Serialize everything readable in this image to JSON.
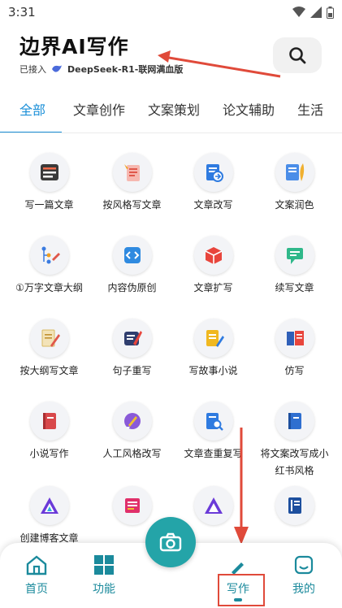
{
  "status": {
    "time": "3:31"
  },
  "header": {
    "title": "边界AI写作",
    "connected_label": "已接入",
    "model_name": "DeepSeek-R1-联网满血版"
  },
  "tabs": [
    {
      "label": "全部",
      "active": true
    },
    {
      "label": "文章创作"
    },
    {
      "label": "文案策划"
    },
    {
      "label": "论文辅助"
    },
    {
      "label": "生活"
    }
  ],
  "tools": [
    {
      "label": "写一篇文章",
      "icon": "notebook-icon"
    },
    {
      "label": "按风格写文章",
      "icon": "style-notes-icon"
    },
    {
      "label": "文章改写",
      "icon": "document-rewrite-icon"
    },
    {
      "label": "文案润色",
      "icon": "polish-icon"
    },
    {
      "label": "①万字文章大纲",
      "icon": "outline-icon"
    },
    {
      "label": "内容伪原创",
      "icon": "code-icon"
    },
    {
      "label": "文章扩写",
      "icon": "cube-icon"
    },
    {
      "label": "续写文章",
      "icon": "continue-chat-icon"
    },
    {
      "label": "按大纲写文章",
      "icon": "outline-pencil-icon"
    },
    {
      "label": "句子重写",
      "icon": "sentence-rewrite-icon"
    },
    {
      "label": "写故事小说",
      "icon": "story-icon"
    },
    {
      "label": "仿写",
      "icon": "imitate-icon"
    },
    {
      "label": "小说写作",
      "icon": "novel-book-icon"
    },
    {
      "label": "人工风格改写",
      "icon": "brush-icon"
    },
    {
      "label": "文章查重复写",
      "icon": "search-document-icon"
    },
    {
      "label": "将文案改写成小红书风格",
      "icon": "red-book-icon"
    },
    {
      "label": "创建博客文章",
      "icon": "blog-logo-icon"
    },
    {
      "label": "",
      "icon": "slides-icon"
    },
    {
      "label": "",
      "icon": "logo-icon"
    },
    {
      "label": "",
      "icon": "binder-icon"
    }
  ],
  "bottom_nav": [
    {
      "label": "首页",
      "icon": "home-icon"
    },
    {
      "label": "功能",
      "icon": "grid-icon"
    },
    {
      "label": "写作",
      "icon": "write-icon"
    },
    {
      "label": "我的",
      "icon": "user-icon"
    }
  ],
  "camera": {
    "icon": "camera-icon"
  },
  "colors": {
    "accent": "#1a8fd8",
    "teal": "#24a4a8",
    "annotation": "#e04a3a"
  }
}
